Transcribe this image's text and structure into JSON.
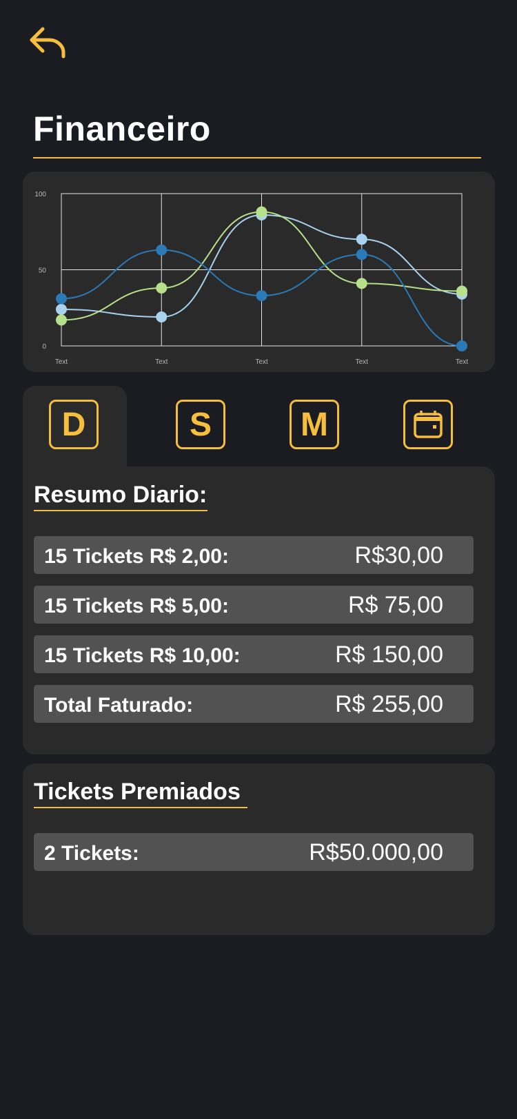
{
  "header": {
    "title": "Financeiro",
    "back_icon": "back-arrow-icon"
  },
  "colors": {
    "accent": "#f5be3d",
    "background": "#1b1b22",
    "card": "#2a2a2a",
    "row": "#525252"
  },
  "chart_data": {
    "type": "line",
    "categories": [
      "Text",
      "Text",
      "Text",
      "Text",
      "Text"
    ],
    "y_ticks": [
      "0",
      "50",
      "100"
    ],
    "ylim": [
      0,
      100
    ],
    "grid": true,
    "series": [
      {
        "color": "#2a7ab8",
        "values": [
          31,
          63,
          33,
          60,
          0
        ]
      },
      {
        "color": "#a8d2ee",
        "values": [
          24,
          19,
          86,
          70,
          34
        ]
      },
      {
        "color": "#b6e089",
        "values": [
          17,
          38,
          88,
          41,
          36
        ]
      }
    ]
  },
  "tabs": [
    {
      "label": "D",
      "name": "tab-daily",
      "active": true
    },
    {
      "label": "S",
      "name": "tab-weekly"
    },
    {
      "label": "M",
      "name": "tab-monthly"
    },
    {
      "icon": "calendar-icon",
      "name": "tab-calendar"
    }
  ],
  "summary": {
    "title": "Resumo Diario:",
    "rows": [
      {
        "label": "15 Tickets R$ 2,00:",
        "value": "R$30,00"
      },
      {
        "label": "15 Tickets R$ 5,00:",
        "value": "R$ 75,00"
      },
      {
        "label": "15 Tickets R$ 10,00:",
        "value": "R$ 150,00"
      },
      {
        "label": "Total Faturado:",
        "value": "R$ 255,00"
      }
    ]
  },
  "prizes": {
    "title": "Tickets Premiados",
    "rows": [
      {
        "label": "2 Tickets:",
        "value": "R$50.000,00"
      }
    ]
  }
}
